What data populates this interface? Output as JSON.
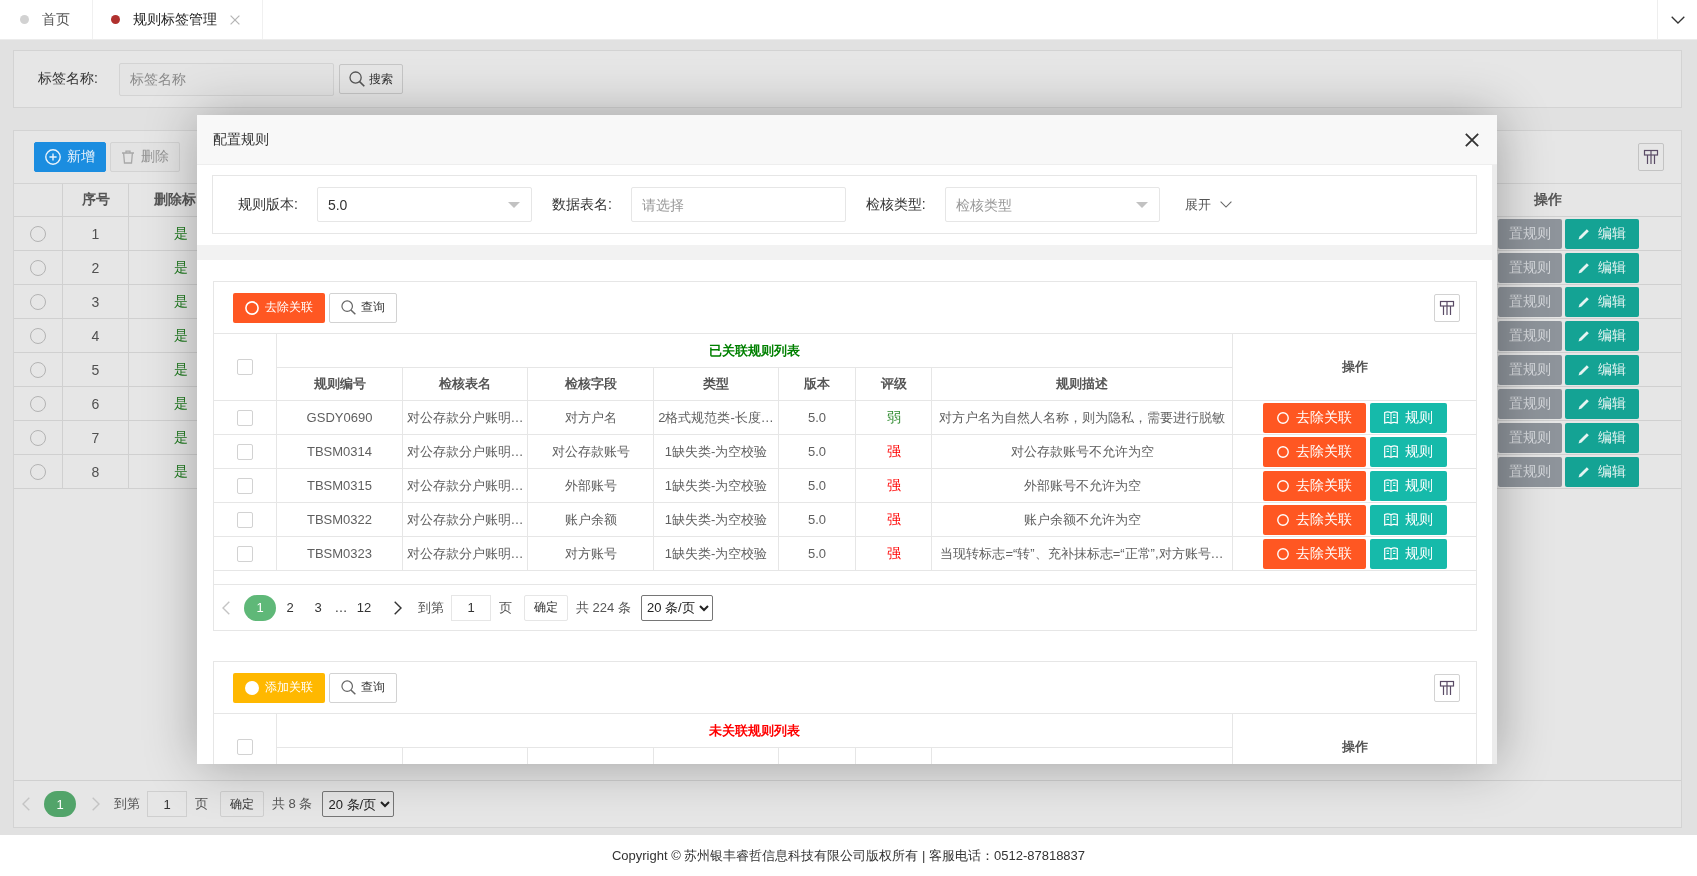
{
  "tabs": [
    {
      "label": "首页",
      "selected": false,
      "closable": false
    },
    {
      "label": "规则标签管理",
      "selected": true,
      "closable": true
    }
  ],
  "search": {
    "label": "标签名称:",
    "placeholder": "标签名称",
    "button": "搜索"
  },
  "toolbar": [
    {
      "kind": "add",
      "label": "新增",
      "disabled": false
    },
    {
      "kind": "delete",
      "label": "删除",
      "disabled": true
    }
  ],
  "table": {
    "columns": [
      "序号",
      "删除标"
    ],
    "action_column": "操作",
    "rows": [
      {
        "selected": false,
        "index": "1",
        "deleted_flag": "是",
        "actions": [
          {
            "kind": "configure",
            "label": "置规则"
          },
          {
            "kind": "edit",
            "label": "编辑"
          }
        ]
      },
      {
        "selected": false,
        "index": "2",
        "deleted_flag": "是",
        "actions": [
          {
            "kind": "configure",
            "label": "置规则"
          },
          {
            "kind": "edit",
            "label": "编辑"
          }
        ]
      },
      {
        "selected": false,
        "index": "3",
        "deleted_flag": "是",
        "actions": [
          {
            "kind": "configure",
            "label": "置规则"
          },
          {
            "kind": "edit",
            "label": "编辑"
          }
        ]
      },
      {
        "selected": false,
        "index": "4",
        "deleted_flag": "是",
        "actions": [
          {
            "kind": "configure",
            "label": "置规则"
          },
          {
            "kind": "edit",
            "label": "编辑"
          }
        ]
      },
      {
        "selected": false,
        "index": "5",
        "deleted_flag": "是",
        "actions": [
          {
            "kind": "configure",
            "label": "置规则"
          },
          {
            "kind": "edit",
            "label": "编辑"
          }
        ]
      },
      {
        "selected": false,
        "index": "6",
        "deleted_flag": "是",
        "actions": [
          {
            "kind": "configure",
            "label": "置规则"
          },
          {
            "kind": "edit",
            "label": "编辑"
          }
        ]
      },
      {
        "selected": false,
        "index": "7",
        "deleted_flag": "是",
        "actions": [
          {
            "kind": "configure",
            "label": "置规则"
          },
          {
            "kind": "edit",
            "label": "编辑"
          }
        ]
      },
      {
        "selected": false,
        "index": "8",
        "deleted_flag": "是",
        "actions": [
          {
            "kind": "configure",
            "label": "置规则"
          },
          {
            "kind": "edit",
            "label": "编辑"
          }
        ]
      }
    ]
  },
  "pagination": {
    "prev_disabled": true,
    "next_disabled": true,
    "pages": [
      {
        "kind": "page",
        "label": "1",
        "selected": true
      }
    ],
    "goto_label": "到第",
    "page_input": "1",
    "page_unit": "页",
    "confirm": "确定",
    "total": "共 8 条",
    "page_size": "20 条/页"
  },
  "modal": {
    "title": "配置规则",
    "filters": [
      {
        "kind": "select",
        "label": "规则版本:",
        "value": "5.0"
      },
      {
        "kind": "input",
        "label": "数据表名:",
        "placeholder": "请选择"
      },
      {
        "kind": "select",
        "label": "检核类型:",
        "placeholder": "检核类型"
      }
    ],
    "expand": "展开",
    "sections": [
      {
        "action": {
          "kind": "remove",
          "label": "去除关联"
        },
        "query": "查询",
        "title": "已关联规则列表",
        "color": "#008000",
        "select_all_checked": false,
        "columns": [
          "规则编号",
          "检核表名",
          "检核字段",
          "类型",
          "版本",
          "评级",
          "规则描述"
        ],
        "action_column": "操作",
        "rows": [
          {
            "checked": false,
            "code": "GSDY0690",
            "table_name": "对公存款分户账明…",
            "field": "对方户名",
            "type": "2格式规范类-长度…",
            "version": "5.0",
            "rating": {
              "text": "弱",
              "color": "#2e8b2e"
            },
            "description": "对方户名为自然人名称，则为隐私，需要进行脱敏",
            "actions": [
              {
                "kind": "remove",
                "label": "去除关联"
              },
              {
                "kind": "rules",
                "label": "规则"
              }
            ]
          },
          {
            "checked": false,
            "code": "TBSM0314",
            "table_name": "对公存款分户账明…",
            "field": "对公存款账号",
            "type": "1缺失类-为空校验",
            "version": "5.0",
            "rating": {
              "text": "强",
              "color": "#ff0000"
            },
            "description": "对公存款账号不允许为空",
            "actions": [
              {
                "kind": "remove",
                "label": "去除关联"
              },
              {
                "kind": "rules",
                "label": "规则"
              }
            ]
          },
          {
            "checked": false,
            "code": "TBSM0315",
            "table_name": "对公存款分户账明…",
            "field": "外部账号",
            "type": "1缺失类-为空校验",
            "version": "5.0",
            "rating": {
              "text": "强",
              "color": "#ff0000"
            },
            "description": "外部账号不允许为空",
            "actions": [
              {
                "kind": "remove",
                "label": "去除关联"
              },
              {
                "kind": "rules",
                "label": "规则"
              }
            ]
          },
          {
            "checked": false,
            "code": "TBSM0322",
            "table_name": "对公存款分户账明…",
            "field": "账户余额",
            "type": "1缺失类-为空校验",
            "version": "5.0",
            "rating": {
              "text": "强",
              "color": "#ff0000"
            },
            "description": "账户余额不允许为空",
            "actions": [
              {
                "kind": "remove",
                "label": "去除关联"
              },
              {
                "kind": "rules",
                "label": "规则"
              }
            ]
          },
          {
            "checked": false,
            "code": "TBSM0323",
            "table_name": "对公存款分户账明…",
            "field": "对方账号",
            "type": "1缺失类-为空校验",
            "version": "5.0",
            "rating": {
              "text": "强",
              "color": "#ff0000"
            },
            "description": "当现转标志=“转”、充补抹标志=“正常”,对方账号…",
            "actions": [
              {
                "kind": "remove",
                "label": "去除关联"
              },
              {
                "kind": "rules",
                "label": "规则"
              }
            ]
          }
        ],
        "pagination": {
          "prev_disabled": true,
          "next_disabled": false,
          "pages": [
            {
              "kind": "page",
              "label": "1",
              "selected": true
            },
            {
              "kind": "page",
              "label": "2",
              "selected": false
            },
            {
              "kind": "page",
              "label": "3",
              "selected": false
            },
            {
              "kind": "ellipsis",
              "label": "…",
              "selected": false
            },
            {
              "kind": "page",
              "label": "12",
              "selected": false
            }
          ],
          "goto_label": "到第",
          "page_input": "1",
          "page_unit": "页",
          "confirm": "确定",
          "total": "共 224 条",
          "page_size": "20 条/页"
        }
      },
      {
        "action": {
          "kind": "add",
          "label": "添加关联"
        },
        "query": "查询",
        "title": "未关联规则列表",
        "color": "#ff0000",
        "select_all_checked": false,
        "action_column": "操作"
      }
    ]
  },
  "footer": "Copyright © 苏州银丰睿哲信息科技有限公司版权所有 | 客服电话：0512-87818837"
}
